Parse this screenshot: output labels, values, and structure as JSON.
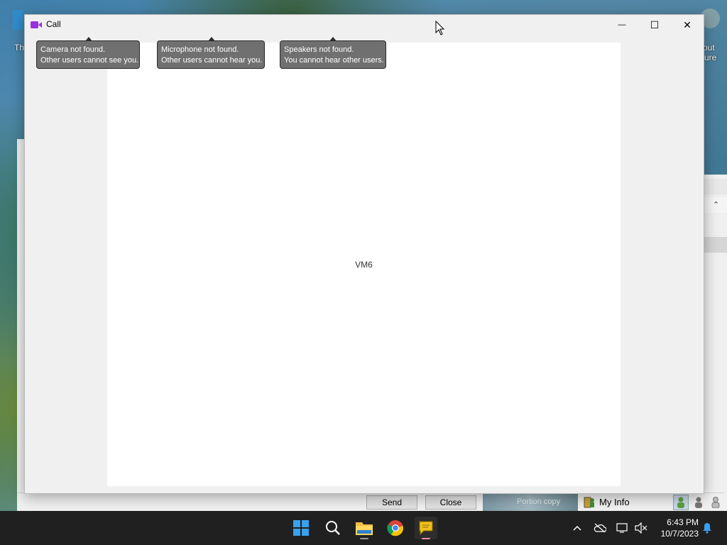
{
  "desktop": {
    "edge_text_left": "Th",
    "edge_text_right_1": "out",
    "edge_text_right_2": "ure"
  },
  "window": {
    "title": "Call",
    "controls": {
      "minimize": "—",
      "maximize": "☐",
      "close": "✕"
    }
  },
  "tooltips": [
    {
      "line1": "Camera not found.",
      "line2": "Other users cannot see you."
    },
    {
      "line1": "Microphone not found.",
      "line2": "Other users cannot hear you."
    },
    {
      "line1": "Speakers not found.",
      "line2": "You cannot hear other users."
    }
  ],
  "video": {
    "participant": "VM6"
  },
  "chat_bar": {
    "send_label": "Send",
    "close_label": "Close",
    "photo_text": "Portion copy",
    "my_info_label": "My Info"
  },
  "taskbar": {
    "apps": [
      "start-icon",
      "search-icon",
      "file-explorer-icon",
      "chrome-icon",
      "messenger-icon"
    ],
    "time": "6:43 PM",
    "date": "10/7/2023"
  }
}
